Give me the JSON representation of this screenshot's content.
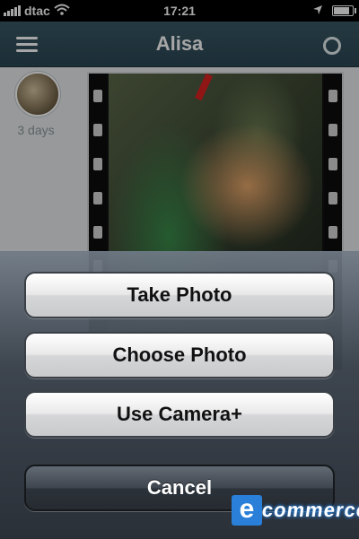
{
  "status_bar": {
    "carrier": "dtac",
    "time": "17:21",
    "battery_level": 0.9,
    "icons": [
      "signal-icon",
      "wifi-icon",
      "location-arrow-icon",
      "battery-icon"
    ]
  },
  "nav": {
    "title": "Alisa",
    "left_icon": "menu-icon",
    "right_icon": "profile-icon"
  },
  "feed": {
    "post": {
      "time_ago": "3 days"
    }
  },
  "action_sheet": {
    "take_photo": "Take Photo",
    "choose_photo": "Choose Photo",
    "use_camera_plus": "Use Camera+",
    "cancel": "Cancel"
  },
  "watermark": {
    "logo_letter": "e",
    "text": "commerce",
    "color": "#2a7fd8"
  }
}
